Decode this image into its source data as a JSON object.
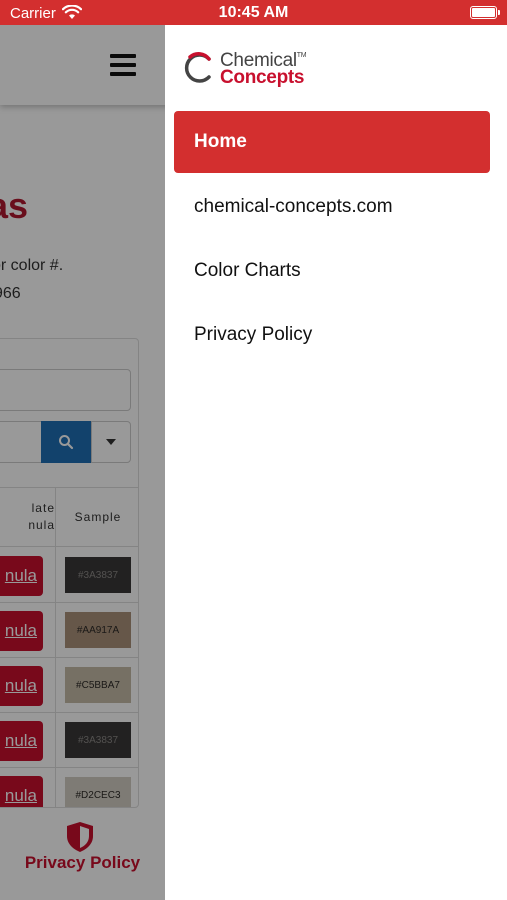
{
  "status_bar": {
    "carrier": "Carrier",
    "time": "10:45 AM"
  },
  "colors": {
    "status_bar_bg": "#d32f2f",
    "accent_red": "#c8102e",
    "menu_active_bg": "#d32f2f",
    "search_button_blue": "#1f6fb5"
  },
  "background_page": {
    "title_fragment": "as",
    "text_line1": "or color #.",
    "text_line2": "966",
    "table_header_col1_line1": "late",
    "table_header_col1_line2": "nula",
    "table_header_col2": "Sample",
    "rows": [
      {
        "button_label": "nula",
        "swatch_code": "#3A3837",
        "swatch_color": "#3a3837",
        "text_color": "#8a8886"
      },
      {
        "button_label": "nula",
        "swatch_code": "#AA917A",
        "swatch_color": "#aa917a",
        "text_color": "#2d2a27"
      },
      {
        "button_label": "nula",
        "swatch_code": "#C5BBA7",
        "swatch_color": "#c5bba7",
        "text_color": "#2d2a27"
      },
      {
        "button_label": "nula",
        "swatch_code": "#3A3837",
        "swatch_color": "#3a3837",
        "text_color": "#8a8886"
      },
      {
        "button_label": "nula",
        "swatch_code": "#D2CEC3",
        "swatch_color": "#d2cec3",
        "text_color": "#2d2a27"
      }
    ],
    "footer_label": "Privacy Policy"
  },
  "drawer": {
    "logo": {
      "line1": "Chemical",
      "tm": "TM",
      "line2": "Concepts"
    },
    "menu_items": [
      {
        "label": "Home",
        "active": true
      },
      {
        "label": "chemical-concepts.com",
        "active": false
      },
      {
        "label": "Color Charts",
        "active": false
      },
      {
        "label": "Privacy Policy",
        "active": false
      }
    ]
  }
}
